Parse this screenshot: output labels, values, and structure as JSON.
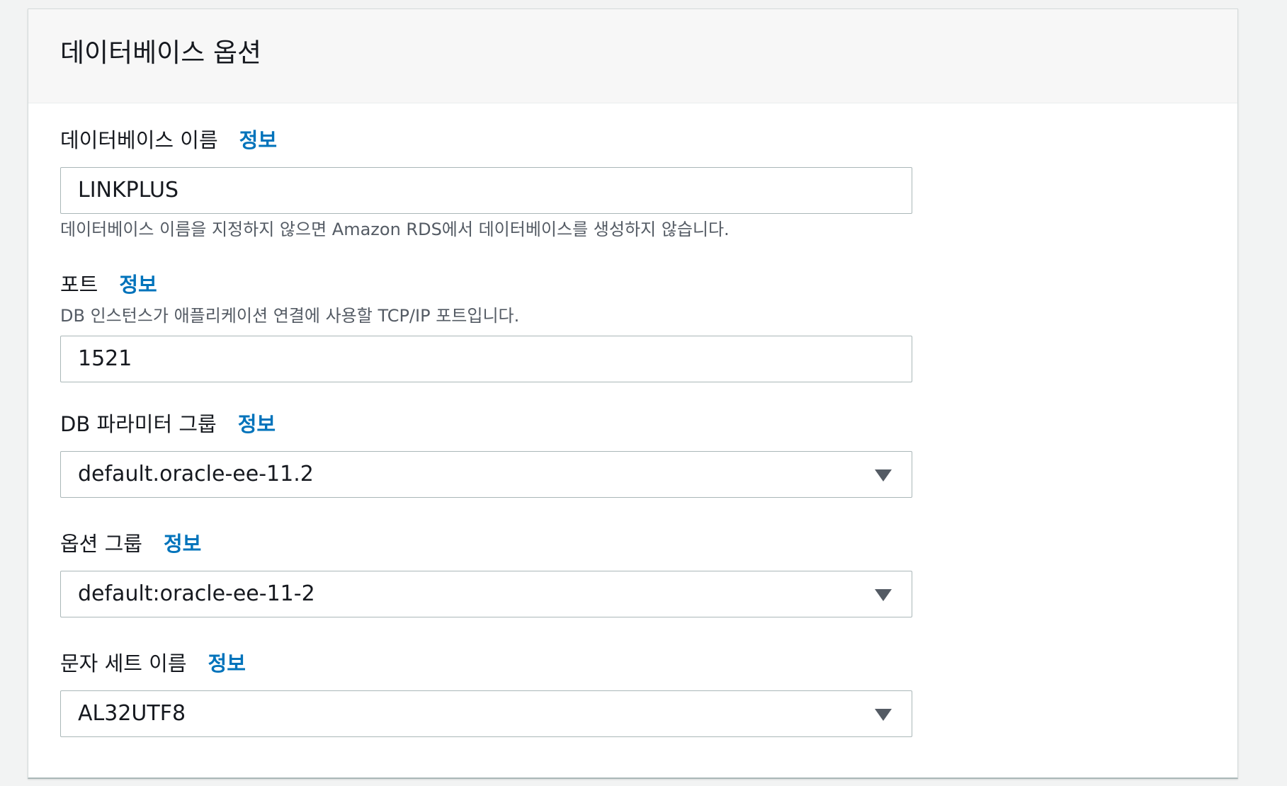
{
  "section": {
    "title": "데이터베이스 옵션"
  },
  "fields": {
    "db_name": {
      "label": "데이터베이스 이름",
      "info": "정보",
      "value": "LINKPLUS",
      "hint": "데이터베이스 이름을 지정하지 않으면 Amazon RDS에서 데이터베이스를 생성하지 않습니다."
    },
    "port": {
      "label": "포트",
      "info": "정보",
      "hint": "DB 인스턴스가 애플리케이션 연결에 사용할 TCP/IP 포트입니다.",
      "value": "1521"
    },
    "param_group": {
      "label": "DB 파라미터 그룹",
      "info": "정보",
      "value": "default.oracle-ee-11.2"
    },
    "option_group": {
      "label": "옵션 그룹",
      "info": "정보",
      "value": "default:oracle-ee-11-2"
    },
    "charset": {
      "label": "문자 세트 이름",
      "info": "정보",
      "value": "AL32UTF8"
    }
  },
  "icons": {
    "dropdown": "caret-down-icon"
  },
  "colors": {
    "link": "#0073bb",
    "header_bg": "#f7f7f7",
    "border": "#aab7b8",
    "hint_text": "#545b64"
  }
}
